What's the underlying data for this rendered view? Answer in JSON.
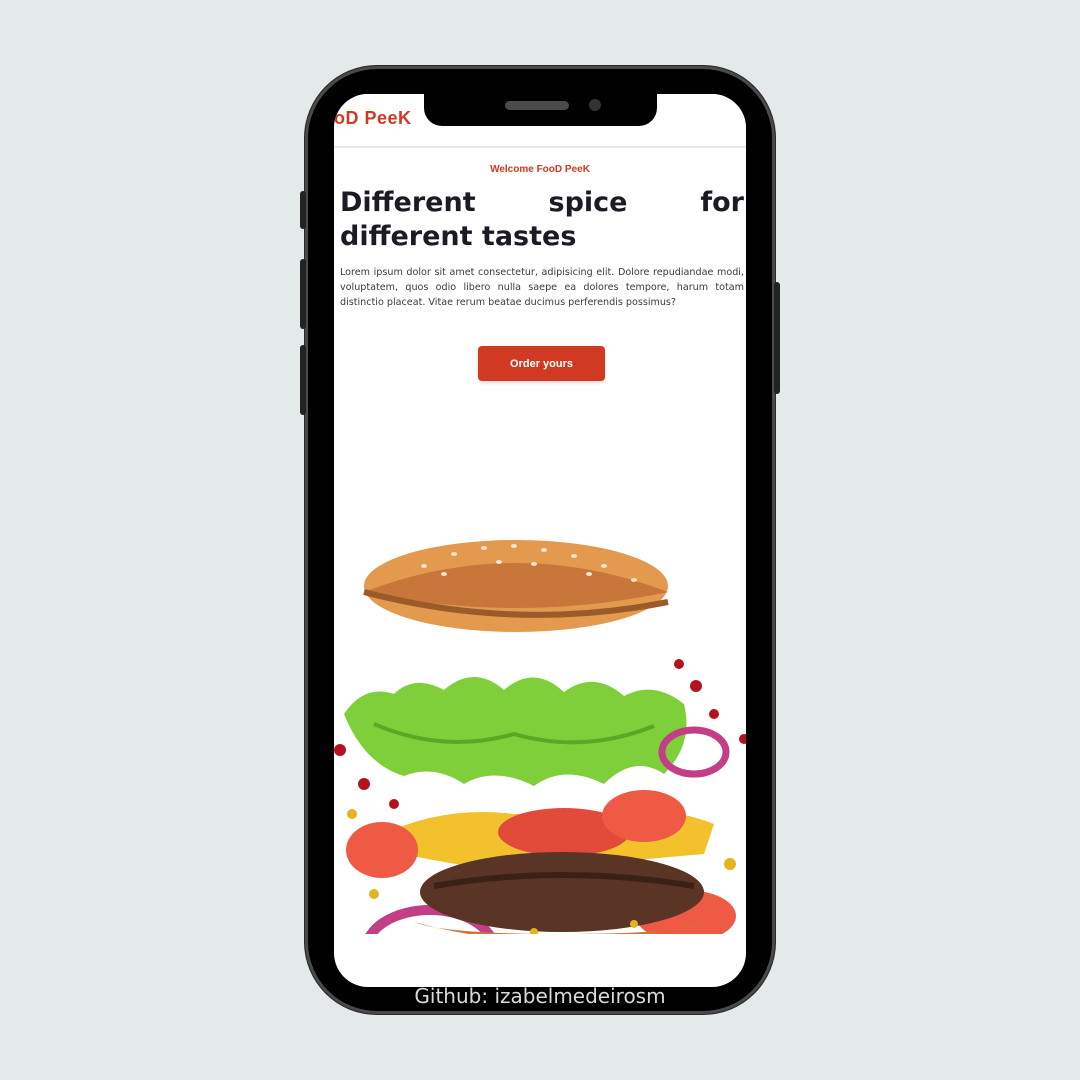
{
  "app": {
    "logo_part_a": "oD ",
    "logo_part_b": "PeeK"
  },
  "hero": {
    "welcome": "Welcome FooD PeeK",
    "headline": "Different spice for different tastes",
    "body": "Lorem ipsum dolor sit amet consectetur, adipisicing elit. Dolore repudiandae modi, voluptatem, quos odio libero nulla saepe ea dolores tempore, harum totam distinctio placeat. Vitae rerum beatae ducimus perferendis possimus?",
    "cta_label": "Order yours",
    "image": "burger-image"
  },
  "footer": {
    "credit": "Github: izabelmedeirosm"
  },
  "colors": {
    "accent": "#d13a22",
    "background": "#e4e9e9",
    "headline": "#1b1b25"
  }
}
